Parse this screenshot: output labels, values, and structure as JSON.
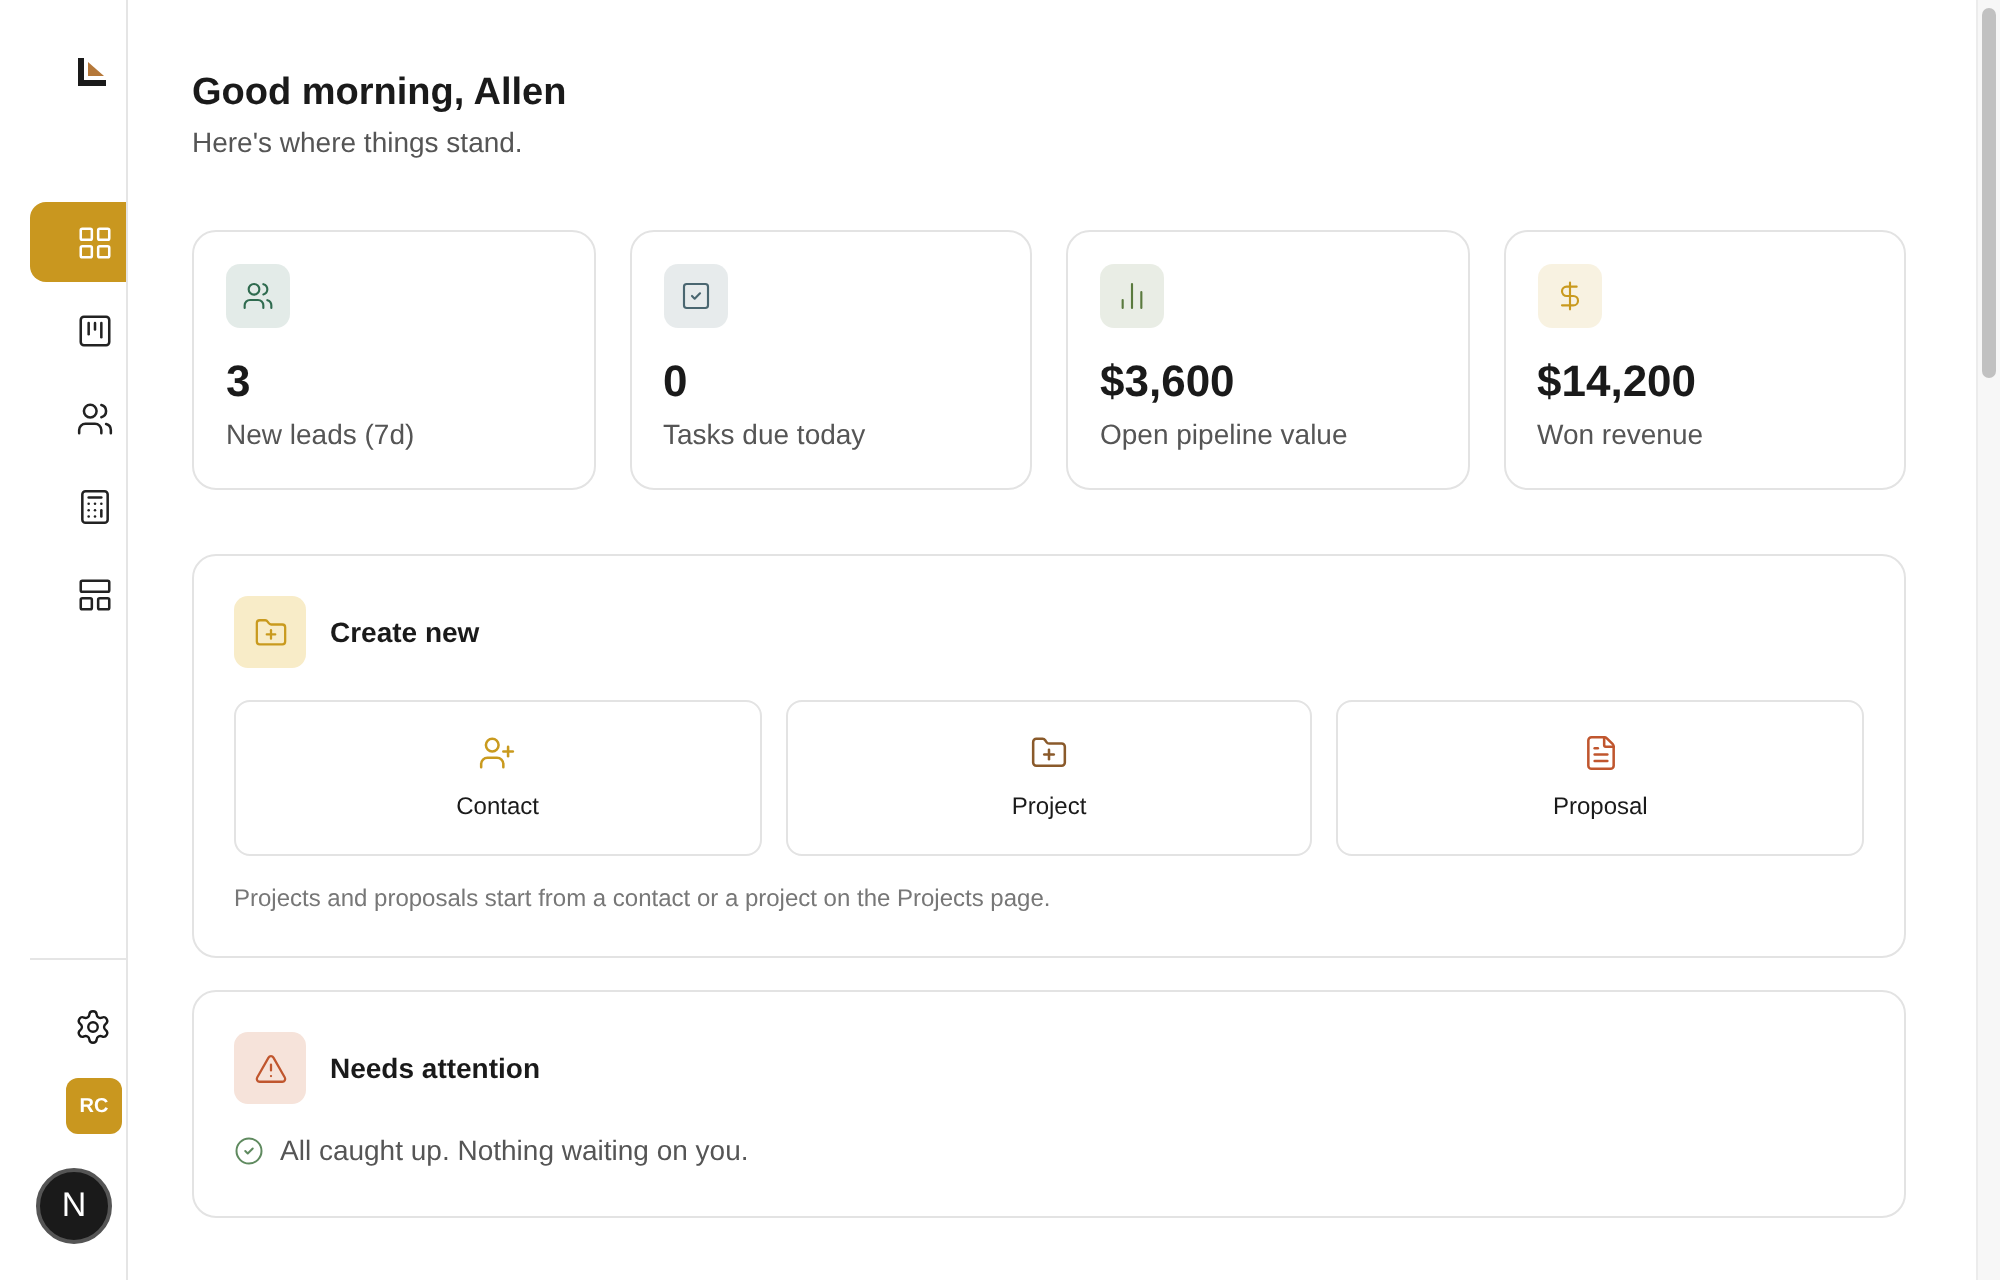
{
  "sidebar": {
    "nav": [
      {
        "kind": "dashboard",
        "selected": true
      },
      {
        "kind": "board",
        "selected": false
      },
      {
        "kind": "contacts",
        "selected": false
      },
      {
        "kind": "calculator",
        "selected": false
      },
      {
        "kind": "layout",
        "selected": false
      }
    ],
    "avatar": "RC",
    "badge": "N"
  },
  "header": {
    "title": "Good morning, Allen",
    "subtitle": "Here's where things stand."
  },
  "stats": [
    {
      "kind": "leads",
      "value": "3",
      "label": "New leads (7d)",
      "color": "#2f6b4f"
    },
    {
      "kind": "tasks",
      "value": "0",
      "label": "Tasks due today",
      "color": "#4a6670"
    },
    {
      "kind": "pipeline",
      "value": "$3,600",
      "label": "Open pipeline value",
      "color": "#5a7a3e"
    },
    {
      "kind": "revenue",
      "value": "$14,200",
      "label": "Won revenue",
      "color": "#c99a1e"
    }
  ],
  "create": {
    "title": "Create new",
    "actions": [
      {
        "kind": "contact",
        "label": "Contact",
        "color": "#c99a1e"
      },
      {
        "kind": "project",
        "label": "Project",
        "color": "#8a5a2b"
      },
      {
        "kind": "proposal",
        "label": "Proposal",
        "color": "#c0562e"
      }
    ],
    "note": "Projects and proposals start from a contact or a project on the Projects page."
  },
  "attention": {
    "title": "Needs attention",
    "message": "All caught up. Nothing waiting on you."
  }
}
